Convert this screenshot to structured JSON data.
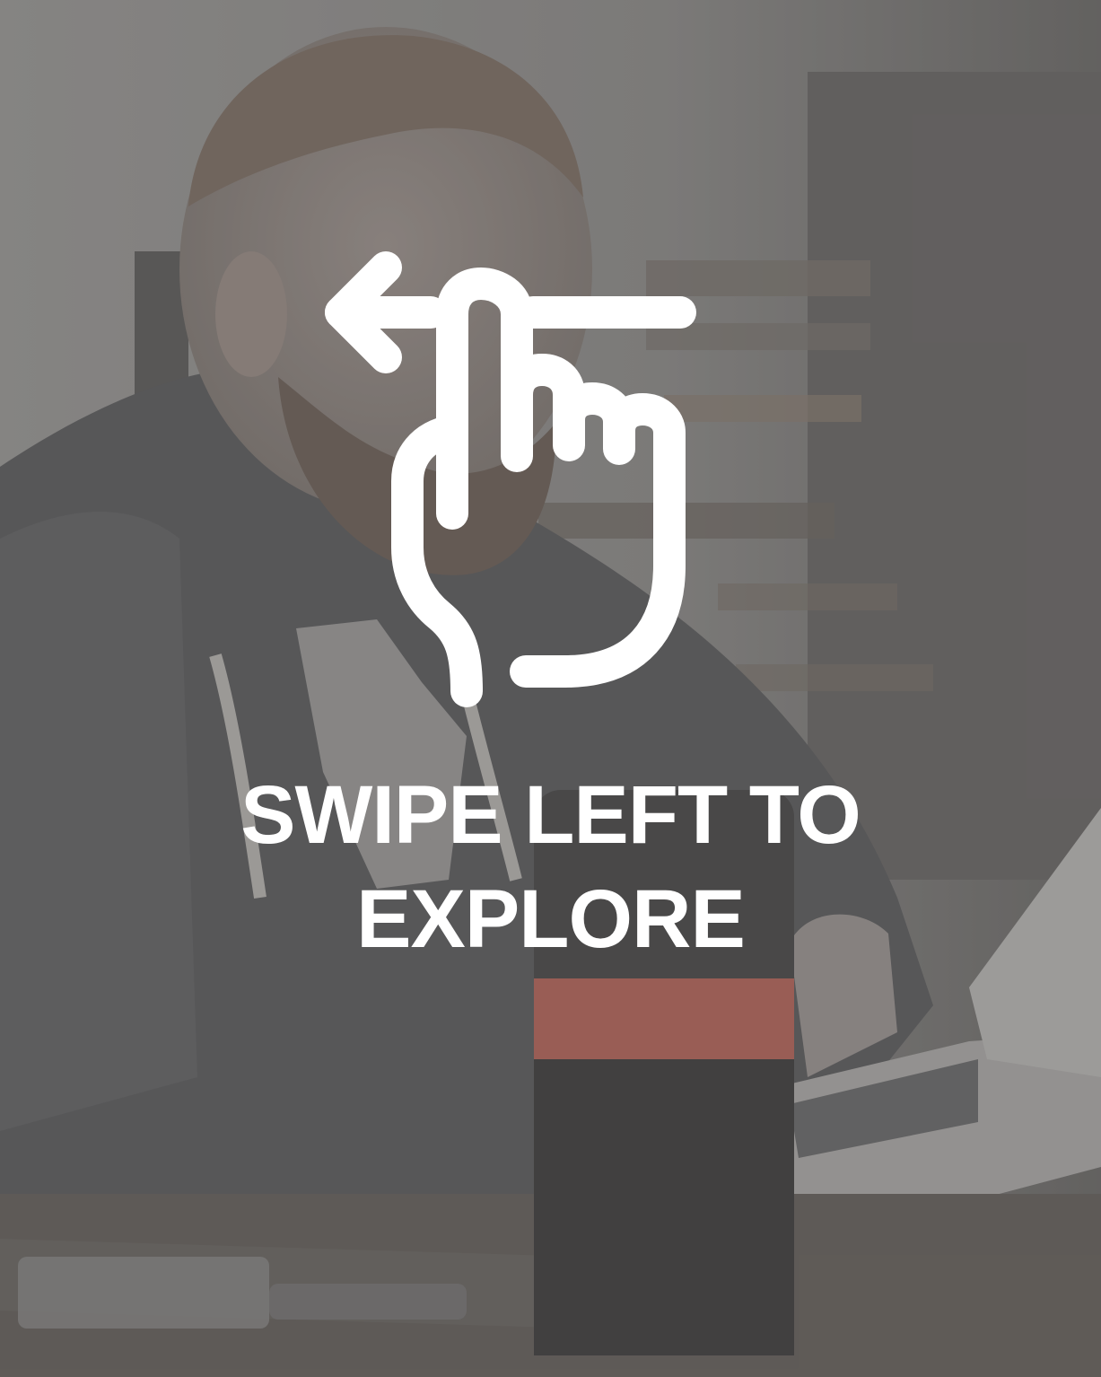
{
  "caption": {
    "line1": "SWIPE LEFT TO",
    "line2": "EXPLORE"
  },
  "icon": "swipe-left-hand-icon",
  "colors": {
    "overlay": "#808080",
    "text": "#ffffff",
    "icon": "#ffffff",
    "accent_cup_band": "#a5544a"
  }
}
